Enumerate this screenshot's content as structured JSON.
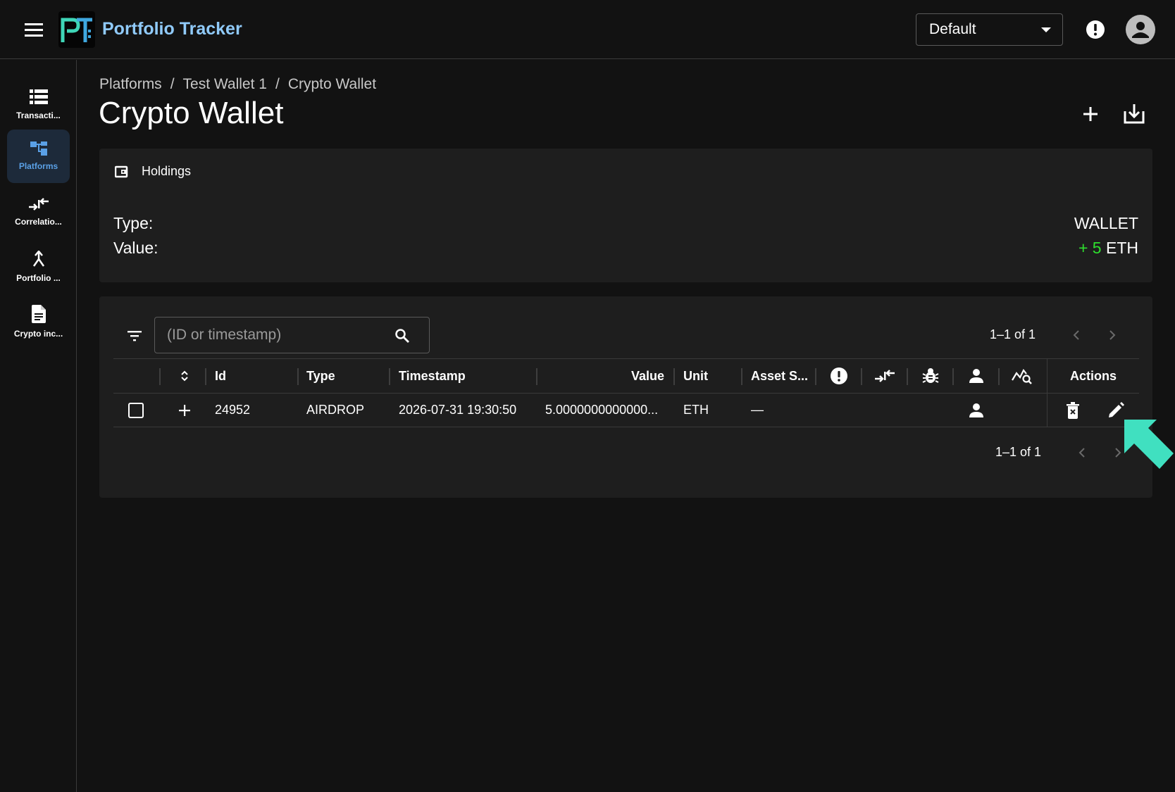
{
  "app": {
    "title": "Portfolio Tracker",
    "logo_text": "PT"
  },
  "header": {
    "profile_select_value": "Default"
  },
  "sidebar": {
    "items": [
      {
        "label": "Transacti...",
        "icon": "list-icon",
        "active": false
      },
      {
        "label": "Platforms",
        "icon": "platforms-icon",
        "active": true
      },
      {
        "label": "Correlatio...",
        "icon": "correlation-icon",
        "active": false
      },
      {
        "label": "Portfolio ...",
        "icon": "merge-icon",
        "active": false
      },
      {
        "label": "Crypto inc...",
        "icon": "document-icon",
        "active": false
      }
    ]
  },
  "breadcrumb": {
    "items": [
      "Platforms",
      "Test Wallet 1",
      "Crypto Wallet"
    ],
    "separator": "/"
  },
  "page": {
    "title": "Crypto Wallet"
  },
  "holdings": {
    "heading": "Holdings",
    "type_label": "Type:",
    "type_value": "WALLET",
    "value_label": "Value:",
    "value_sign_amount": "+ 5",
    "value_unit": "ETH"
  },
  "table": {
    "search_placeholder": "(ID or timestamp)",
    "pager_top": "1–1 of 1",
    "pager_bottom": "1–1 of 1",
    "columns": {
      "id": "Id",
      "type": "Type",
      "timestamp": "Timestamp",
      "value": "Value",
      "unit": "Unit",
      "asset": "Asset S...",
      "actions": "Actions"
    },
    "rows": [
      {
        "id": "24952",
        "type": "AIRDROP",
        "timestamp": "2026-07-31 19:30:50",
        "value": "5.0000000000000...",
        "unit": "ETH",
        "asset": "—"
      }
    ]
  },
  "colors": {
    "accent": "#90caf9",
    "positive": "#2ee02e",
    "cursor": "#40e0c0",
    "background": "#121212",
    "card": "#1e1e1e"
  }
}
